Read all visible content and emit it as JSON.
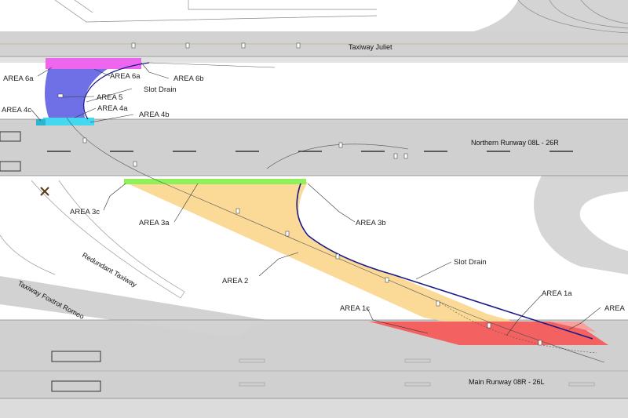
{
  "runways": {
    "taxiway_juliet": "Taxiway Juliet",
    "northern_runway": "Northern Runway 08L - 26R",
    "main_runway": "Main Runway 08R - 26L",
    "redundant_taxiway": "Redundant Taxiway",
    "taxiway_foxtrot_romeo": "Taxiway Foxtrot Romeo"
  },
  "areas": {
    "area_6a_left": "AREA 6a",
    "area_6a_right": "AREA 6a",
    "area_6b": "AREA 6b",
    "slot_drain_top": "Slot Drain",
    "area_5": "AREA 5",
    "area_4a": "AREA 4a",
    "area_4c": "AREA 4c",
    "area_4b": "AREA 4b",
    "area_3c": "AREA 3c",
    "area_3a": "AREA 3a",
    "area_3b": "AREA 3b",
    "slot_drain_bottom": "Slot Drain",
    "area_2": "AREA 2",
    "area_1a": "AREA 1a",
    "area_1c": "AREA 1c",
    "area_1b_partial": "AREA"
  },
  "colors": {
    "pavement": "#d0d0d0",
    "area_6a": "#ee66ee",
    "area_5": "#6f6fe6",
    "area_4": "#44d7f0",
    "area_3c": "#8ff05a",
    "area_2": "#fbd78f",
    "area_1": "#f45b5b",
    "slot_drain": "#1a1a88"
  }
}
